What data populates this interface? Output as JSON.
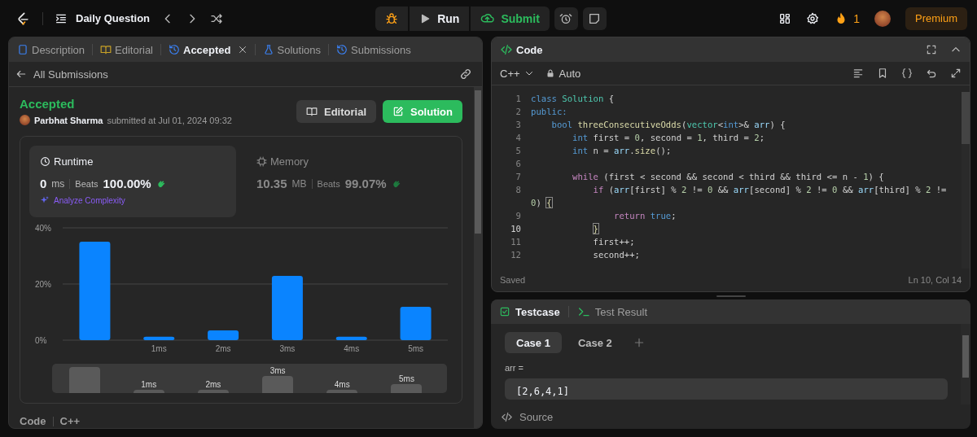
{
  "nav": {
    "title": "Daily Question"
  },
  "actions": {
    "run": "Run",
    "submit": "Submit"
  },
  "user": {
    "streak": "1",
    "premium": "Premium"
  },
  "left": {
    "tabs": [
      {
        "label": "Description",
        "kind": "doc",
        "selected": false,
        "closable": false
      },
      {
        "label": "Editorial",
        "kind": "book",
        "selected": false,
        "closable": false
      },
      {
        "label": "Accepted",
        "kind": "history",
        "selected": true,
        "closable": true
      },
      {
        "label": "Solutions",
        "kind": "flask",
        "selected": false,
        "closable": false
      },
      {
        "label": "Submissions",
        "kind": "history",
        "selected": false,
        "closable": false
      }
    ],
    "back": "All Submissions",
    "status": "Accepted",
    "author": "Parbhat Sharma",
    "submitted": "submitted at Jul 01, 2024 09:32",
    "buttons": [
      {
        "label": "Editorial",
        "kind": "book"
      },
      {
        "label": "Solution",
        "kind": "edit"
      }
    ],
    "stats": [
      {
        "title": "Runtime",
        "kind": "clock",
        "value": "0",
        "unit": "ms",
        "beats_label": "Beats",
        "beats": "100.00%",
        "selected": true
      },
      {
        "title": "Memory",
        "kind": "chip",
        "value": "10.35",
        "unit": "MB",
        "beats_label": "Beats",
        "beats": "99.07%",
        "selected": false
      }
    ],
    "analyze": "Analyze Complexity",
    "chart_data": {
      "type": "bar",
      "x": [
        0,
        1,
        2,
        3,
        4,
        5
      ],
      "values": [
        35.1,
        1.2,
        3.5,
        22.9,
        1.2,
        11.9
      ],
      "xlim": [
        -0.5,
        5.5
      ],
      "ylim": [
        0,
        40
      ],
      "yticks": [
        {
          "value": 0,
          "label": "0%"
        },
        {
          "value": 20,
          "label": "20%"
        },
        {
          "value": 40,
          "label": "40%"
        }
      ],
      "xticks": [
        {
          "value": 1,
          "label": "1ms"
        },
        {
          "value": 2,
          "label": "2ms"
        },
        {
          "value": 3,
          "label": "3ms"
        },
        {
          "value": 4,
          "label": "4ms"
        },
        {
          "value": 5,
          "label": "5ms"
        }
      ]
    },
    "overview_labels": [
      "1ms",
      "2ms",
      "3ms",
      "4ms",
      "5ms"
    ],
    "footer": [
      "Code",
      "C++"
    ]
  },
  "editor": {
    "title": "Code",
    "language": "C++",
    "mode": "Auto",
    "status": "Saved",
    "cursor": "Ln 10, Col 14",
    "lines": [
      {
        "num": "1",
        "current": false,
        "segs": [
          {
            "text": "class",
            "kind": "kw"
          },
          {
            "text": " Solution",
            "kind": "type"
          },
          {
            "text": " {",
            "kind": "p"
          }
        ]
      },
      {
        "num": "2",
        "current": false,
        "segs": [
          {
            "text": "public:",
            "kind": "kw"
          }
        ]
      },
      {
        "num": "3",
        "current": false,
        "segs": [
          {
            "text": "    bool",
            "kind": "kw"
          },
          {
            "text": " threeConsecutiveOdds",
            "kind": "fn"
          },
          {
            "text": "(",
            "kind": "p"
          },
          {
            "text": "vector",
            "kind": "type"
          },
          {
            "text": "<",
            "kind": "p"
          },
          {
            "text": "int",
            "kind": "kw"
          },
          {
            "text": ">&",
            "kind": "p"
          },
          {
            "text": " arr",
            "kind": "var"
          },
          {
            "text": ") {",
            "kind": "p"
          }
        ]
      },
      {
        "num": "4",
        "current": false,
        "segs": [
          {
            "text": "        int",
            "kind": "kw"
          },
          {
            "text": " first = ",
            "kind": "p"
          },
          {
            "text": "0",
            "kind": "num"
          },
          {
            "text": ", second = ",
            "kind": "p"
          },
          {
            "text": "1",
            "kind": "num"
          },
          {
            "text": ", third = ",
            "kind": "p"
          },
          {
            "text": "2",
            "kind": "num"
          },
          {
            "text": ";",
            "kind": "p"
          }
        ]
      },
      {
        "num": "5",
        "current": false,
        "segs": [
          {
            "text": "        int",
            "kind": "kw"
          },
          {
            "text": " n = ",
            "kind": "p"
          },
          {
            "text": "arr",
            "kind": "var"
          },
          {
            "text": ".",
            "kind": "p"
          },
          {
            "text": "size",
            "kind": "fn"
          },
          {
            "text": "();",
            "kind": "p"
          }
        ]
      },
      {
        "num": "6",
        "current": false
      },
      {
        "num": "7",
        "current": false,
        "segs": [
          {
            "text": "        while",
            "kind": "ctrl"
          },
          {
            "text": " (first < second && second < third && third <= n - ",
            "kind": "p"
          },
          {
            "text": "1",
            "kind": "num"
          },
          {
            "text": ") {",
            "kind": "p"
          }
        ]
      },
      {
        "num": "8",
        "current": false,
        "segs": [
          {
            "text": "            if",
            "kind": "ctrl"
          },
          {
            "text": " (",
            "kind": "p"
          },
          {
            "text": "arr",
            "kind": "var"
          },
          {
            "text": "[first] % ",
            "kind": "p"
          },
          {
            "text": "2",
            "kind": "num"
          },
          {
            "text": " != ",
            "kind": "p"
          },
          {
            "text": "0",
            "kind": "num"
          },
          {
            "text": " && ",
            "kind": "p"
          },
          {
            "text": "arr",
            "kind": "var"
          },
          {
            "text": "[second] % ",
            "kind": "p"
          },
          {
            "text": "2",
            "kind": "num"
          },
          {
            "text": " != ",
            "kind": "p"
          },
          {
            "text": "0",
            "kind": "num"
          },
          {
            "text": " && ",
            "kind": "p"
          },
          {
            "text": "arr",
            "kind": "var"
          },
          {
            "text": "[third] % ",
            "kind": "p"
          },
          {
            "text": "2",
            "kind": "num"
          },
          {
            "text": " !=",
            "kind": "p"
          }
        ]
      },
      {
        "segs": [
          {
            "text": "0",
            "kind": "num"
          },
          {
            "text": ") ",
            "kind": "p"
          },
          {
            "text": "{",
            "kind": "match"
          }
        ]
      },
      {
        "num": "9",
        "current": false,
        "segs": [
          {
            "text": "                return",
            "kind": "ctrl"
          },
          {
            "text": " true",
            "kind": "kw"
          },
          {
            "text": ";",
            "kind": "p"
          }
        ]
      },
      {
        "num": "10",
        "current": true,
        "segs": [
          {
            "text": "            }",
            "kind": "match"
          }
        ]
      },
      {
        "num": "11",
        "current": false,
        "segs": [
          {
            "text": "            first++;",
            "kind": "p"
          }
        ]
      },
      {
        "num": "12",
        "current": false,
        "segs": [
          {
            "text": "            second++;",
            "kind": "p"
          }
        ]
      }
    ]
  },
  "testcase": {
    "tabs": [
      {
        "label": "Testcase",
        "kind": "check",
        "selected": true
      },
      {
        "label": "Test Result",
        "kind": "terminal",
        "selected": false
      }
    ],
    "cases": [
      {
        "label": "Case 1",
        "selected": true
      },
      {
        "label": "Case 2",
        "selected": false
      }
    ],
    "param": "arr =",
    "value": "[2,6,4,1]",
    "source": "Source"
  }
}
